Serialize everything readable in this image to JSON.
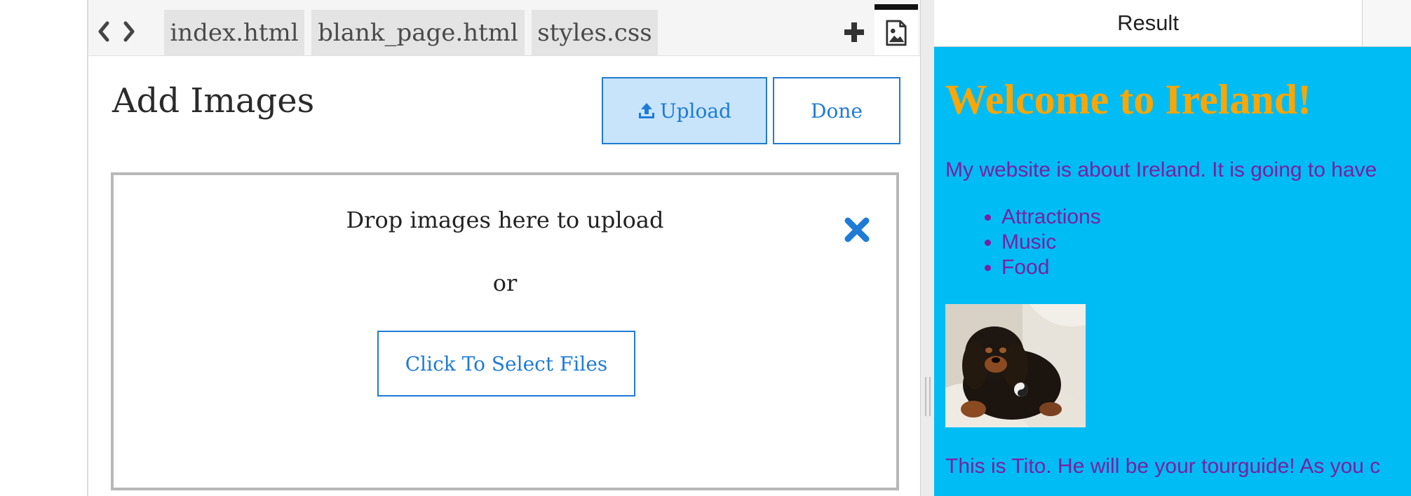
{
  "editor": {
    "nav": {
      "back_icon": "chevron-left-icon",
      "forward_icon": "chevron-right-icon"
    },
    "tabs": [
      {
        "label": "index.html"
      },
      {
        "label": "blank_page.html"
      },
      {
        "label": "styles.css"
      }
    ],
    "add_tab_icon": "plus-icon",
    "image_tab_icon": "image-file-icon"
  },
  "add_images": {
    "title": "Add Images",
    "upload_label": "Upload",
    "upload_icon": "upload-icon",
    "done_label": "Done",
    "drop_text": "Drop images here to upload",
    "or_text": "or",
    "select_files_label": "Click To Select Files",
    "close_icon": "close-icon"
  },
  "result": {
    "tab_label": "Result",
    "heading": "Welcome to Ireland!",
    "paragraph": "My website is about Ireland. It is going to have",
    "list_items": [
      "Attractions",
      "Music",
      "Food"
    ],
    "caption": "This is Tito. He will be your tourguide! As you c",
    "colors": {
      "background": "#00bcf4",
      "heading": "#ffa500",
      "text": "#7b1fa2"
    }
  },
  "colors": {
    "accent": "#1f7bd6",
    "upload_bg": "#c8e4fb"
  }
}
